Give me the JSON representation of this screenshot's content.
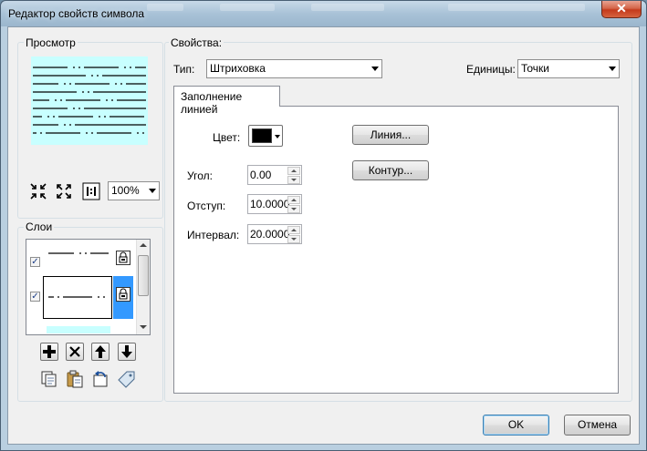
{
  "window": {
    "title": "Редактор свойств символа",
    "close_label": "✕"
  },
  "preview": {
    "group_label": "Просмотр",
    "zoom_value": "100%",
    "bg_color": "#c8ffff"
  },
  "layers": {
    "group_label": "Слои",
    "items": [
      {
        "checked": true,
        "selected": false
      },
      {
        "checked": true,
        "selected": true
      }
    ]
  },
  "properties": {
    "group_label": "Свойства:",
    "type_label": "Тип:",
    "type_value": "Штриховка",
    "units_label": "Единицы:",
    "units_value": "Точки",
    "tab_label": "Заполнение линией",
    "color_label": "Цвет:",
    "angle_label": "Угол:",
    "angle_value": "0.00",
    "offset_label": "Отступ:",
    "offset_value": "10.0000",
    "interval_label": "Интервал:",
    "interval_value": "20.0000",
    "line_button": "Линия...",
    "contour_button": "Контур..."
  },
  "footer": {
    "ok": "OK",
    "cancel": "Отмена"
  },
  "colors": {
    "selection": "#3399ff",
    "swatch": "#000000"
  }
}
